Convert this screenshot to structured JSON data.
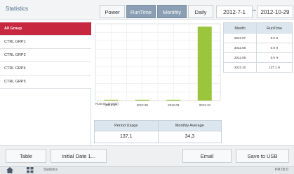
{
  "window": {
    "title": "Statistics"
  },
  "toolbar": {
    "tabs": [
      "Power",
      "RunTime",
      "Monthly",
      "Daily"
    ],
    "date_from": "2012-7-1",
    "date_sep": "~",
    "date_to": "2012-10-29"
  },
  "groups": [
    "All Group",
    "CTRL GRP1",
    "CTRL GRP2",
    "CTRL GRP4",
    "CTRL GRP5"
  ],
  "selected_group": "All Group",
  "chart_data": {
    "type": "bar",
    "categories": [
      "2012.07",
      "2012.08",
      "2012.09",
      "2012.10"
    ],
    "values": [
      0,
      0,
      0,
      137.1
    ],
    "ylabel": "",
    "legend": "Running time(H)"
  },
  "usage": {
    "period_label": "Period Usage",
    "period_value": "137,1",
    "monthly_label": "Monthly Average",
    "monthly_value": "34,3"
  },
  "side_table": {
    "headers": [
      "Month",
      "RunTime"
    ],
    "rows": [
      [
        "2012.07",
        "0.0 H"
      ],
      [
        "2012.08",
        "0.0 H"
      ],
      [
        "2012.09",
        "0.0 H"
      ],
      [
        "2012.10",
        "137.1 H"
      ]
    ]
  },
  "buttons": {
    "table": "Table",
    "initial_date": "Initial Date 1...",
    "email": "Email",
    "save_usb": "Save to USB"
  },
  "statusbar": {
    "text": "Statistics",
    "time": "PM 05:0"
  },
  "colors": {
    "accent": "#c8283f",
    "bar": "#9bc53d",
    "active_tab": "#8a9fb3"
  }
}
